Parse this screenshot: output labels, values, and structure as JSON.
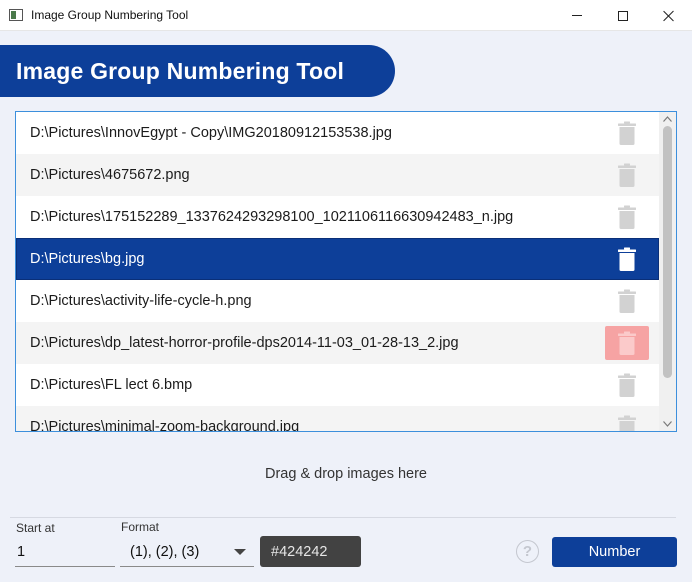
{
  "window": {
    "title": "Image Group Numbering Tool",
    "icon": "app-window-icon",
    "controls": [
      "minimize-icon",
      "maximize-icon",
      "close-icon"
    ]
  },
  "header": {
    "title": "Image Group Numbering Tool"
  },
  "file_list": {
    "items": [
      {
        "path": "D:\\Pictures\\InnovEgypt - Copy\\IMG20180912153538.jpg",
        "state": "normal"
      },
      {
        "path": "D:\\Pictures\\4675672.png",
        "state": "normal"
      },
      {
        "path": "D:\\Pictures\\175152289_1337624293298100_1021106116630942483_n.jpg",
        "state": "normal"
      },
      {
        "path": "D:\\Pictures\\bg.jpg",
        "state": "selected"
      },
      {
        "path": "D:\\Pictures\\activity-life-cycle-h.png",
        "state": "normal"
      },
      {
        "path": "D:\\Pictures\\dp_latest-horror-profile-dps2014-11-03_01-28-13_2.jpg",
        "state": "delete-hover"
      },
      {
        "path": "D:\\Pictures\\FL lect 6.bmp",
        "state": "normal"
      },
      {
        "path": "D:\\Pictures\\minimal-zoom-background.jpg",
        "state": "normal"
      }
    ],
    "delete_icon": "trash-icon"
  },
  "drop_hint": "Drag & drop images here",
  "controls": {
    "start_label": "Start at",
    "start_value": "1",
    "format_label": "Format",
    "format_value": "(1), (2), (3)",
    "color_value": "#424242",
    "help_label": "?",
    "number_label": "Number"
  },
  "colors": {
    "accent": "#0d3f99",
    "selection_border": "#3c8fdc",
    "delete_hover": "#f6a3a3",
    "color_field": "#424242"
  }
}
